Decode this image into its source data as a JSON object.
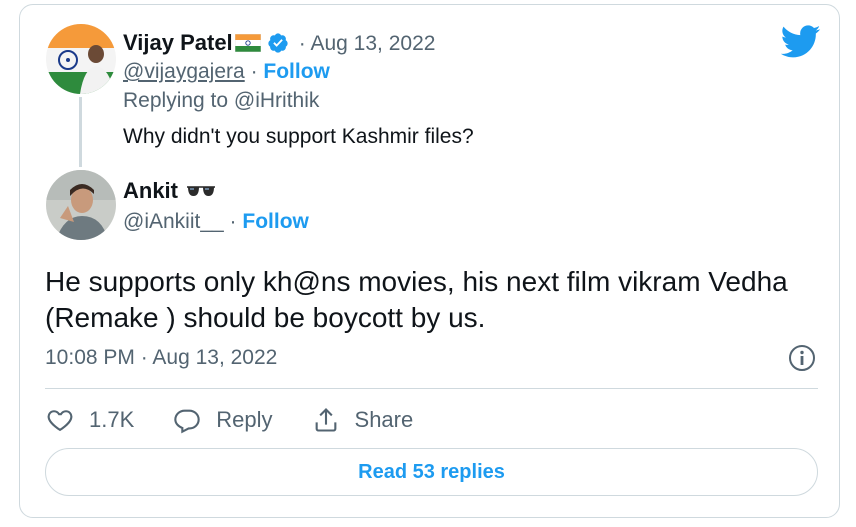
{
  "original_tweet": {
    "display_name": "Vijay Patel",
    "name_emoji": "india-flag-icon",
    "dot": "·",
    "date": "Aug 13, 2022",
    "handle": "@vijaygajera",
    "follow_label": "Follow",
    "replying_prefix": "Replying to ",
    "replying_handle": "@iHrithik",
    "text": "Why didn't you support Kashmir files?"
  },
  "reply_tweet": {
    "display_name": "Ankit",
    "name_emoji": "sunglasses-icon",
    "handle": "@iAnkiit__",
    "dot": "·",
    "follow_label": "Follow",
    "text": "He supports only kh@ns movies, his next film vikram Vedha (Remake ) should be boycott by us.",
    "timestamp": "10:08 PM · Aug 13, 2022"
  },
  "actions": {
    "like_count": "1.7K",
    "reply_label": "Reply",
    "share_label": "Share"
  },
  "read_replies_label": "Read 53 replies",
  "colors": {
    "accent": "#1d9bf0",
    "muted": "#536471",
    "border": "#cfd9de"
  }
}
